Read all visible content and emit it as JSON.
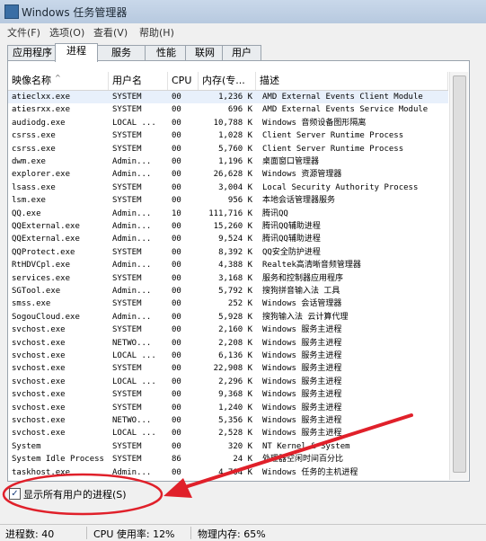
{
  "window": {
    "title": "Windows 任务管理器"
  },
  "menu": [
    "文件(F)",
    "选项(O)",
    "查看(V)",
    "帮助(H)"
  ],
  "tabs": [
    {
      "label": "应用程序",
      "active": false
    },
    {
      "label": "进程",
      "active": true
    },
    {
      "label": "服务",
      "active": false
    },
    {
      "label": "性能",
      "active": false
    },
    {
      "label": "联网",
      "active": false
    },
    {
      "label": "用户",
      "active": false
    }
  ],
  "columns": {
    "name": "映像名称",
    "user": "用户名",
    "cpu": "CPU",
    "mem": "内存(专...",
    "desc": "描述"
  },
  "processes": [
    {
      "name": "atieclxx.exe",
      "user": "SYSTEM",
      "cpu": "00",
      "mem": "1,236 K",
      "desc": "AMD External Events Client Module",
      "selected": true
    },
    {
      "name": "atiesrxx.exe",
      "user": "SYSTEM",
      "cpu": "00",
      "mem": "696 K",
      "desc": "AMD External Events Service Module"
    },
    {
      "name": "audiodg.exe",
      "user": "LOCAL ...",
      "cpu": "00",
      "mem": "10,788 K",
      "desc": "Windows 音频设备图形隔离"
    },
    {
      "name": "csrss.exe",
      "user": "SYSTEM",
      "cpu": "00",
      "mem": "1,028 K",
      "desc": "Client Server Runtime Process"
    },
    {
      "name": "csrss.exe",
      "user": "SYSTEM",
      "cpu": "00",
      "mem": "5,760 K",
      "desc": "Client Server Runtime Process"
    },
    {
      "name": "dwm.exe",
      "user": "Admin...",
      "cpu": "00",
      "mem": "1,196 K",
      "desc": "桌面窗口管理器"
    },
    {
      "name": "explorer.exe",
      "user": "Admin...",
      "cpu": "00",
      "mem": "26,628 K",
      "desc": "Windows 资源管理器"
    },
    {
      "name": "lsass.exe",
      "user": "SYSTEM",
      "cpu": "00",
      "mem": "3,004 K",
      "desc": "Local Security Authority Process"
    },
    {
      "name": "lsm.exe",
      "user": "SYSTEM",
      "cpu": "00",
      "mem": "956 K",
      "desc": "本地会话管理器服务"
    },
    {
      "name": "QQ.exe",
      "user": "Admin...",
      "cpu": "10",
      "mem": "111,716 K",
      "desc": "腾讯QQ"
    },
    {
      "name": "QQExternal.exe",
      "user": "Admin...",
      "cpu": "00",
      "mem": "15,260 K",
      "desc": "腾讯QQ辅助进程"
    },
    {
      "name": "QQExternal.exe",
      "user": "Admin...",
      "cpu": "00",
      "mem": "9,524 K",
      "desc": "腾讯QQ辅助进程"
    },
    {
      "name": "QQProtect.exe",
      "user": "SYSTEM",
      "cpu": "00",
      "mem": "8,392 K",
      "desc": "QQ安全防护进程"
    },
    {
      "name": "RtHDVCpl.exe",
      "user": "Admin...",
      "cpu": "00",
      "mem": "4,388 K",
      "desc": "Realtek高清晰音频管理器"
    },
    {
      "name": "services.exe",
      "user": "SYSTEM",
      "cpu": "00",
      "mem": "3,168 K",
      "desc": "服务和控制器应用程序"
    },
    {
      "name": "SGTool.exe",
      "user": "Admin...",
      "cpu": "00",
      "mem": "5,792 K",
      "desc": "搜狗拼音输入法 工具"
    },
    {
      "name": "smss.exe",
      "user": "SYSTEM",
      "cpu": "00",
      "mem": "252 K",
      "desc": "Windows 会话管理器"
    },
    {
      "name": "SogouCloud.exe",
      "user": "Admin...",
      "cpu": "00",
      "mem": "5,928 K",
      "desc": "搜狗输入法 云计算代理"
    },
    {
      "name": "svchost.exe",
      "user": "SYSTEM",
      "cpu": "00",
      "mem": "2,160 K",
      "desc": "Windows 服务主进程"
    },
    {
      "name": "svchost.exe",
      "user": "NETWO...",
      "cpu": "00",
      "mem": "2,208 K",
      "desc": "Windows 服务主进程"
    },
    {
      "name": "svchost.exe",
      "user": "LOCAL ...",
      "cpu": "00",
      "mem": "6,136 K",
      "desc": "Windows 服务主进程"
    },
    {
      "name": "svchost.exe",
      "user": "SYSTEM",
      "cpu": "00",
      "mem": "22,908 K",
      "desc": "Windows 服务主进程"
    },
    {
      "name": "svchost.exe",
      "user": "LOCAL ...",
      "cpu": "00",
      "mem": "2,296 K",
      "desc": "Windows 服务主进程"
    },
    {
      "name": "svchost.exe",
      "user": "SYSTEM",
      "cpu": "00",
      "mem": "9,368 K",
      "desc": "Windows 服务主进程"
    },
    {
      "name": "svchost.exe",
      "user": "SYSTEM",
      "cpu": "00",
      "mem": "1,240 K",
      "desc": "Windows 服务主进程"
    },
    {
      "name": "svchost.exe",
      "user": "NETWO...",
      "cpu": "00",
      "mem": "5,356 K",
      "desc": "Windows 服务主进程"
    },
    {
      "name": "svchost.exe",
      "user": "LOCAL ...",
      "cpu": "00",
      "mem": "2,528 K",
      "desc": "Windows 服务主进程"
    },
    {
      "name": "System",
      "user": "SYSTEM",
      "cpu": "00",
      "mem": "320 K",
      "desc": "NT Kernel & System"
    },
    {
      "name": "System Idle Process",
      "user": "SYSTEM",
      "cpu": "86",
      "mem": "24 K",
      "desc": "处理器空闲时间百分比"
    },
    {
      "name": "taskhost.exe",
      "user": "Admin...",
      "cpu": "00",
      "mem": "4,704 K",
      "desc": "Windows 任务的主机进程"
    }
  ],
  "show_all_users": {
    "label": "显示所有用户的进程(S)",
    "checked": true,
    "check_glyph": "✓"
  },
  "status": {
    "processes": "进程数: 40",
    "cpu": "CPU 使用率: 12%",
    "memory": "物理内存: 65%"
  },
  "annotation_color": "#e0202a"
}
